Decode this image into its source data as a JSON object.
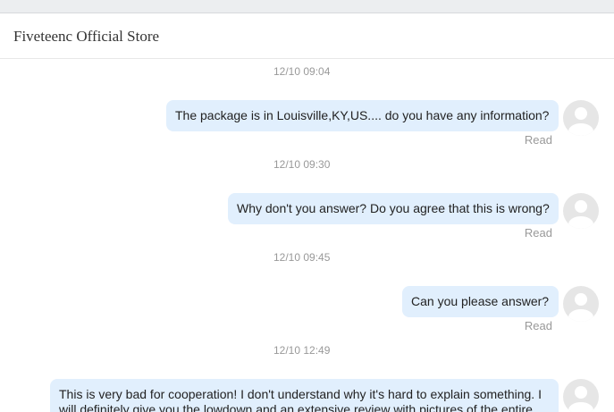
{
  "header": {
    "store_name": "Fiveteenc Official Store"
  },
  "messages": [
    {
      "timestamp": "12/10 09:04",
      "text": "The package is in Louisville,KY,US.... do you have any information?",
      "status": "Read"
    },
    {
      "timestamp": "12/10 09:30",
      "text": "Why don't you answer? Do you agree that this is wrong?",
      "status": "Read"
    },
    {
      "timestamp": "12/10 09:45",
      "text": "Can you please answer?",
      "status": "Read"
    },
    {
      "timestamp": "12/10 12:49",
      "text": "This is very bad for cooperation! I don't understand why it's hard to explain something. I will definitely give you the lowdown and an extensive review with pictures of the entire"
    }
  ],
  "icons": {
    "avatar": "user-avatar-placeholder-icon"
  },
  "colors": {
    "bubble": "#e1effd",
    "muted_text": "#999999",
    "avatar_bg": "#e6e6e6"
  }
}
